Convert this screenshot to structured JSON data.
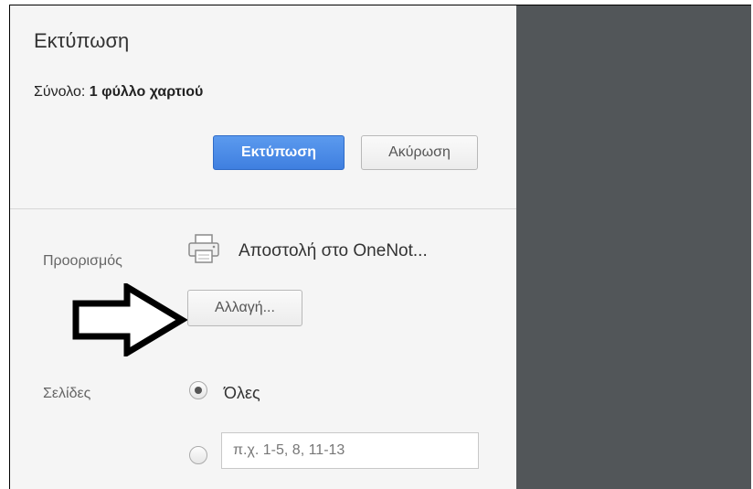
{
  "dialog": {
    "title": "Εκτύπωση",
    "summary_label": "Σύνολο:",
    "summary_value": "1 φύλλο χαρτιού",
    "print_button": "Εκτύπωση",
    "cancel_button": "Ακύρωση"
  },
  "destination": {
    "label": "Προορισμός",
    "printer_icon": "printer-icon",
    "name": "Αποστολή στο OneNot...",
    "change_button": "Αλλαγή..."
  },
  "pages": {
    "label": "Σελίδες",
    "options": [
      {
        "label": "Όλες",
        "checked": true
      },
      {
        "label": "",
        "checked": false
      }
    ],
    "input_placeholder": "π.χ. 1-5, 8, 11-13",
    "input_value": ""
  },
  "annotation": {
    "icon": "arrow-right-outline-icon"
  },
  "colors": {
    "panel_bg": "#f5f5f5",
    "preview_bg": "#525659",
    "primary_button": "#4a8af4"
  }
}
